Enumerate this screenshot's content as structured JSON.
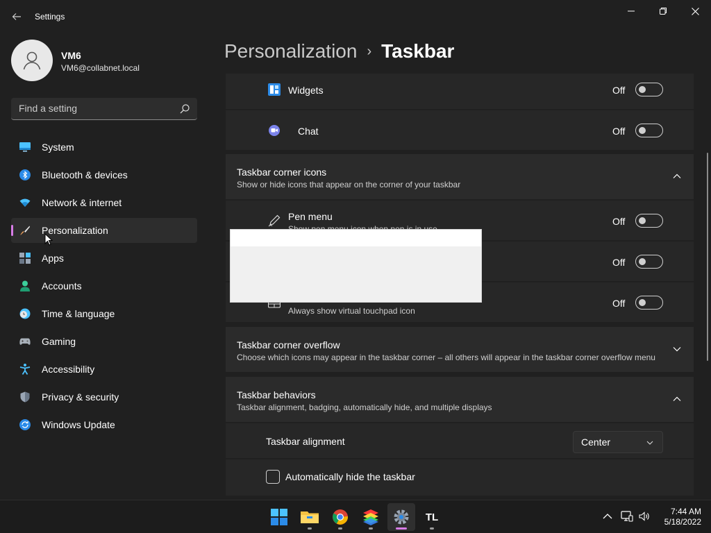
{
  "window": {
    "title": "Settings",
    "back_icon": "back-arrow-icon",
    "controls": [
      "minimize-icon",
      "maximize-icon",
      "close-icon"
    ]
  },
  "profile": {
    "name": "VM6",
    "email": "VM6@collabnet.local"
  },
  "search": {
    "placeholder": "Find a setting",
    "icon": "search-icon"
  },
  "nav": {
    "items": [
      {
        "label": "System",
        "icon": "system-icon",
        "active": false
      },
      {
        "label": "Bluetooth & devices",
        "icon": "bluetooth-icon",
        "active": false
      },
      {
        "label": "Network & internet",
        "icon": "wifi-icon",
        "active": false
      },
      {
        "label": "Personalization",
        "icon": "brush-icon",
        "active": true
      },
      {
        "label": "Apps",
        "icon": "apps-icon",
        "active": false
      },
      {
        "label": "Accounts",
        "icon": "accounts-icon",
        "active": false
      },
      {
        "label": "Time & language",
        "icon": "clock-globe-icon",
        "active": false
      },
      {
        "label": "Gaming",
        "icon": "gamepad-icon",
        "active": false
      },
      {
        "label": "Accessibility",
        "icon": "accessibility-icon",
        "active": false
      },
      {
        "label": "Privacy & security",
        "icon": "shield-icon",
        "active": false
      },
      {
        "label": "Windows Update",
        "icon": "update-icon",
        "active": false
      }
    ]
  },
  "breadcrumb": {
    "parent": "Personalization",
    "separator": "›",
    "current": "Taskbar"
  },
  "taskbar_items": {
    "widgets": {
      "label": "Widgets",
      "state": "Off"
    },
    "chat": {
      "label": "Chat",
      "state": "Off"
    }
  },
  "corner_icons": {
    "title": "Taskbar corner icons",
    "description": "Show or hide icons that appear on the corner of your taskbar",
    "pen_menu": {
      "label": "Pen menu",
      "description": "Show pen menu icon when pen is in use",
      "state": "Off"
    },
    "touch_keyboard": {
      "state": "Off"
    },
    "virtual_touchpad": {
      "description": "Always show virtual touchpad icon",
      "state": "Off"
    }
  },
  "corner_overflow": {
    "title": "Taskbar corner overflow",
    "description": "Choose which icons may appear in the taskbar corner – all others will appear in the taskbar corner overflow menu"
  },
  "behaviors": {
    "title": "Taskbar behaviors",
    "description": "Taskbar alignment, badging, automatically hide, and multiple displays",
    "alignment": {
      "label": "Taskbar alignment",
      "value": "Center"
    },
    "auto_hide": {
      "label": "Automatically hide the taskbar",
      "checked": false
    }
  },
  "system_taskbar": {
    "apps": [
      "start-icon",
      "file-explorer-icon",
      "chrome-icon",
      "bluestacks-icon",
      "settings-icon",
      "tl-app-icon"
    ],
    "tl_label": "TL",
    "tray": [
      "chevron-up-icon",
      "network-icon",
      "volume-icon"
    ],
    "time": "7:44 AM",
    "date": "5/18/2022"
  },
  "colors": {
    "accent": "#d77ce6",
    "background": "#202020",
    "card": "#2b2b2b"
  }
}
